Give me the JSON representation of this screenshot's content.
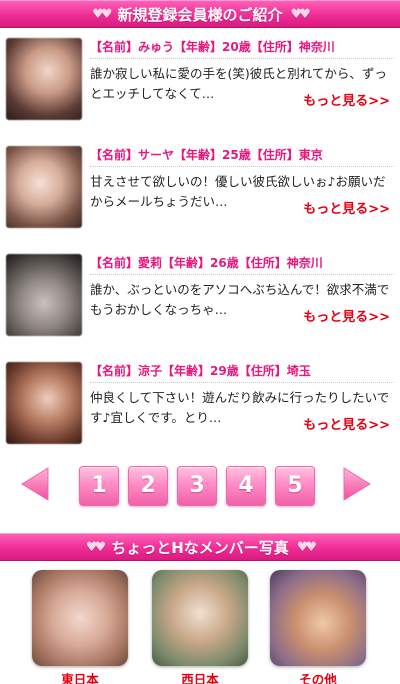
{
  "header": {
    "title": "新規登録会員様のご紹介",
    "left_icon": "hearts-icon",
    "right_icon": "hearts-icon"
  },
  "members": [
    {
      "profile": "【名前】みゅう【年齢】20歳【住所】神奈川",
      "message": "誰か寂しい私に愛の手を(笑)彼氏と別れてから、ずっとエッチしてなくて…",
      "more_label": "もっと見る>>"
    },
    {
      "profile": "【名前】サーヤ【年齢】25歳【住所】東京",
      "message": "甘えさせて欲しいの！優しい彼氏欲しいぉ♪お願いだからメールちょうだい…",
      "more_label": "もっと見る>>"
    },
    {
      "profile": "【名前】愛莉【年齢】26歳【住所】神奈川",
      "message": "誰か、ぶっといのをアソコへぶち込んで！欲求不満でもうおかしくなっちゃ…",
      "more_label": "もっと見る>>"
    },
    {
      "profile": "【名前】涼子【年齢】29歳【住所】埼玉",
      "message": "仲良くして下さい！遊んだり飲みに行ったりしたいです♪宜しくです。とり…",
      "more_label": "もっと見る>>"
    }
  ],
  "pagination": {
    "pages": [
      "1",
      "2",
      "3",
      "4",
      "5"
    ],
    "prev_icon": "arrow-left-icon",
    "next_icon": "arrow-right-icon"
  },
  "photo_section": {
    "title": "ちょっとHなメンバー写真",
    "regions": [
      {
        "label": "東日本"
      },
      {
        "label": "西日本"
      },
      {
        "label": "その他"
      }
    ]
  },
  "colors": {
    "banner": "#ee2d95",
    "accent_pink": "#e8177c",
    "more_red": "#e60012",
    "page_button": "#ff8cc6"
  }
}
